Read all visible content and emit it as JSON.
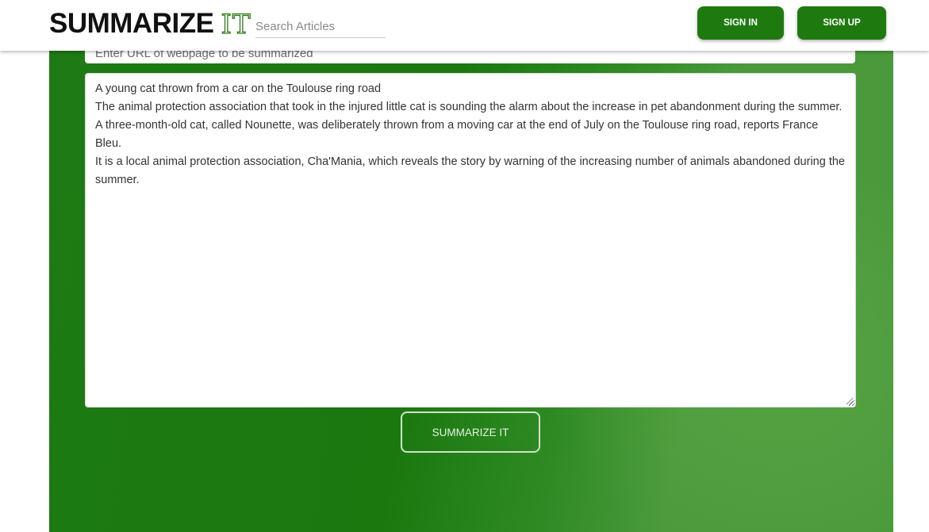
{
  "header": {
    "logo_text": "SUMMARIZE",
    "logo_accent": "IT",
    "search_placeholder": "Search Articles",
    "signin_label": "SIGN IN",
    "signup_label": "SIGN UP"
  },
  "main": {
    "url_placeholder": "Enter URL of webpage to be summarized",
    "article_text": "A young cat thrown from a car on the Toulouse ring road\nThe animal protection association that took in the injured little cat is sounding the alarm about the increase in pet abandonment during the summer.\nA three-month-old cat, called Nounette, was deliberately thrown from a moving car at the end of July on the Toulouse ring road, reports France Bleu.\nIt is a local animal protection association, Cha'Mania, which reveals the story by warning of the increasing number of animals abandoned during the summer.",
    "summarize_label": "SUMMARIZE IT"
  },
  "colors": {
    "brand_green": "#1e7a0f",
    "hero_green": "#1b780f",
    "hero_light_green": "#4a9a3c"
  }
}
